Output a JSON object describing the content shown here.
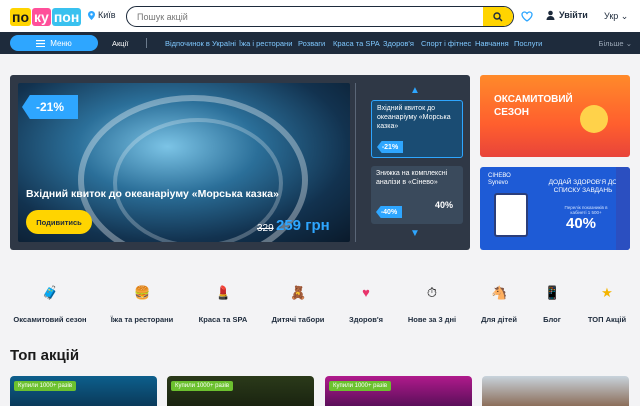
{
  "header": {
    "logo_letters": [
      "по",
      "ку",
      "пон"
    ],
    "city": "Київ",
    "search_placeholder": "Пошук акцій",
    "login_label": "Увійти",
    "language": "Укр"
  },
  "nav": {
    "menu_label": "Меню",
    "promos_label": "Акції",
    "items": [
      "Відпочинок в Україні",
      "Їжа і ресторани",
      "Розваги",
      "Краса та SPA",
      "Здоров'я",
      "Спорт і фітнес",
      "Навчання",
      "Послуги"
    ],
    "more_label": "Більше"
  },
  "hero": {
    "discount": "-21%",
    "title": "Вхідний квиток до океанаріуму «Морська казка»",
    "button_label": "Подивитись",
    "old_price": "329",
    "price": "259 грн",
    "thumbnails": [
      {
        "title": "Вхідний квиток до океанаріуму «Морська казка»",
        "discount": "-21%"
      },
      {
        "title": "Знижка на комплексні аналізи в «Сінево»",
        "discount": "-40%",
        "side_value": "40%"
      }
    ]
  },
  "banners": {
    "velvet": {
      "title": "ОКСАМИТОВИЙ СЕЗОН"
    },
    "synevo": {
      "logo_line1": "СІНЕВО",
      "logo_line2": "Synevo",
      "text": "ДОДАЙ ЗДОРОВ'Я ДО СПИСКУ ЗАВДАНЬ",
      "sub": "Перелік показників в кабінеті 1 500+",
      "percent": "40%"
    }
  },
  "categories": [
    {
      "icon": "suitcase-icon",
      "label": "Оксамитовий сезон"
    },
    {
      "icon": "burger-icon",
      "label": "Їжа та ресторани"
    },
    {
      "icon": "lipstick-icon",
      "label": "Краса та SPA"
    },
    {
      "icon": "kids-icon",
      "label": "Дитячі табори"
    },
    {
      "icon": "heart-icon",
      "label": "Здоров'я"
    },
    {
      "icon": "clock-icon",
      "label": "Нове за 3 дні"
    },
    {
      "icon": "horse-icon",
      "label": "Для дітей"
    },
    {
      "icon": "phone-icon",
      "label": "Блог"
    },
    {
      "icon": "star-icon",
      "label": "ТОП Акцій"
    }
  ],
  "top": {
    "title": "Топ акцій",
    "cards": [
      {
        "tag": "Купили 1000+ разів"
      },
      {
        "tag": "Купили 1000+ разів"
      },
      {
        "tag": "Купили 1000+ разів"
      },
      {
        "tag": ""
      }
    ]
  },
  "colors": {
    "accent_blue": "#2ea6ff",
    "yellow": "#ffd400",
    "navy": "#1e2b3c"
  }
}
